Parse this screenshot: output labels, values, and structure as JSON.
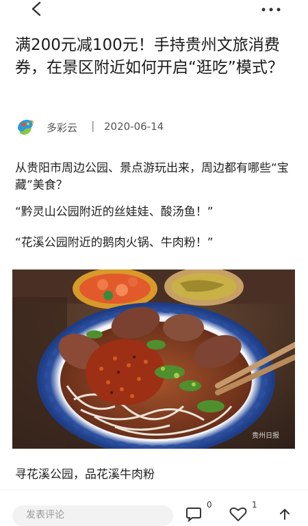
{
  "header": {
    "back_icon": "chevron-left-icon",
    "more_icon": "more-dots-icon"
  },
  "article": {
    "title": "满200元减100元！手持贵州文旅消费券，在景区附近如何开启“逛吃”模式？",
    "author": "多彩云",
    "separator": "|",
    "date": "2020-06-14",
    "paragraphs": [
      "从贵阳市周边公园、景点游玩出来，周边都有哪些“宝藏”美食？",
      "“黔灵山公园附近的丝娃娃、酸汤鱼！”",
      "“花溪公园附近的鹅肉火锅、牛肉粉！”"
    ],
    "photo_watermark": "贵州日报",
    "caption": "寻花溪公园，品花溪牛肉粉"
  },
  "bottom_bar": {
    "comment_placeholder": "发表评论",
    "comment_count": "0",
    "like_count": "1"
  },
  "colors": {
    "background": "#ffffff",
    "text": "#1f1f1f",
    "meta": "#555555"
  }
}
